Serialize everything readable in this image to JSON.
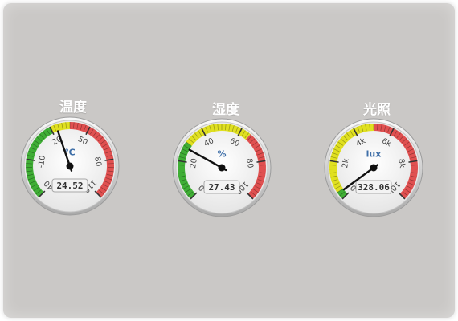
{
  "gauges": [
    {
      "title": "温度",
      "unit": "℃",
      "value_text": "24.52",
      "value": 24.52,
      "min": -40,
      "max": 110,
      "tick_labels": [
        "-40",
        "-10",
        "20",
        "50",
        "80",
        "110"
      ],
      "bands": [
        {
          "from": -40,
          "to": 20,
          "color": "#3fae35"
        },
        {
          "from": 20,
          "to": 35,
          "color": "#e0e020"
        },
        {
          "from": 35,
          "to": 110,
          "color": "#e05050"
        }
      ]
    },
    {
      "title": "湿度",
      "unit": "%",
      "value_text": "27.43",
      "value": 27.43,
      "min": 0,
      "max": 100,
      "tick_labels": [
        "0",
        "20",
        "40",
        "60",
        "80",
        "100"
      ],
      "bands": [
        {
          "from": 0,
          "to": 30,
          "color": "#3fae35"
        },
        {
          "from": 30,
          "to": 65,
          "color": "#e0e020"
        },
        {
          "from": 65,
          "to": 100,
          "color": "#e05050"
        }
      ]
    },
    {
      "title": "光照",
      "unit": "lux",
      "value_text": "328.06",
      "value": 328.06,
      "min": 0,
      "max": 10000,
      "tick_labels": [
        "0",
        "2k",
        "4k",
        "6k",
        "8k",
        "10k"
      ],
      "bands": [
        {
          "from": 0,
          "to": 400,
          "color": "#3fae35"
        },
        {
          "from": 400,
          "to": 5000,
          "color": "#e0e020"
        },
        {
          "from": 5000,
          "to": 10000,
          "color": "#e05050"
        }
      ]
    }
  ]
}
